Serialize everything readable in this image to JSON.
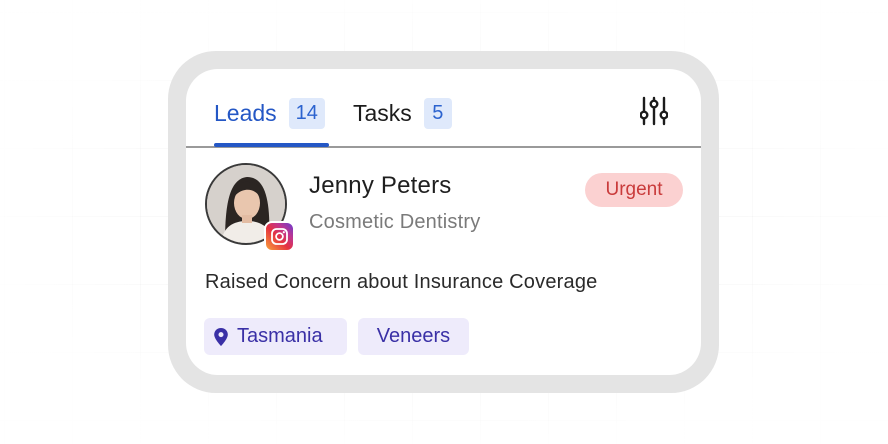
{
  "tabs": [
    {
      "label": "Leads",
      "count": "14",
      "active": true
    },
    {
      "label": "Tasks",
      "count": "5",
      "active": false
    }
  ],
  "icons": {
    "filter": "sliders-icon",
    "location": "map-pin-icon",
    "social": "instagram-icon"
  },
  "lead": {
    "name": "Jenny Peters",
    "category": "Cosmetic Dentistry",
    "priority": "Urgent",
    "concern": "Raised Concern about Insurance Coverage",
    "tags": [
      "Tasmania",
      "Veneers"
    ]
  },
  "colors": {
    "accent": "#2457c5",
    "count_bg": "#dfe9fb",
    "urgent_bg": "#fbd1d1",
    "urgent_text": "#c93b3b",
    "tag_bg": "#eeebfb",
    "tag_text": "#3a30a6"
  }
}
